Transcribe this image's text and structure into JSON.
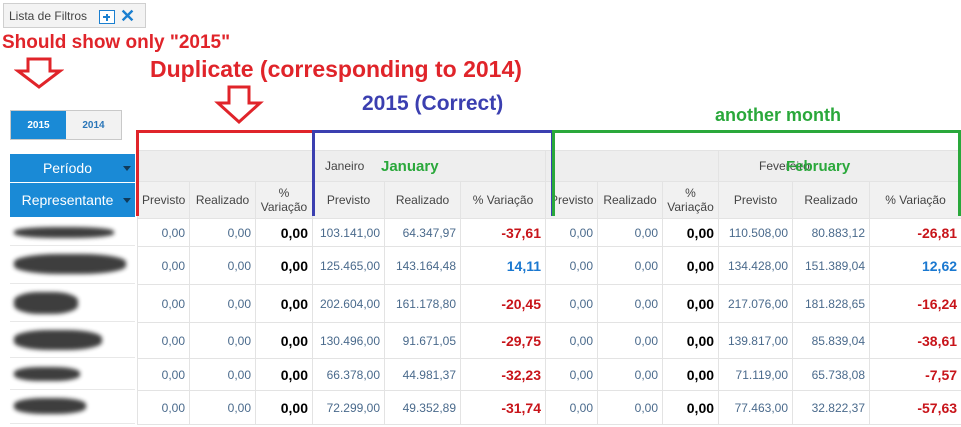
{
  "filter_tab": {
    "label": "Lista de Filtros"
  },
  "annotations": {
    "show_only": "Should show only \"2015\"",
    "duplicate": "Duplicate (corresponding to 2014)",
    "correct": "2015 (Correct)",
    "another_month": "another month",
    "january": "January",
    "february": "February"
  },
  "years": [
    "2015",
    "2014"
  ],
  "fields": {
    "periodo": "Período",
    "representante": "Representante"
  },
  "months": [
    "Janeiro",
    "Fevereiro"
  ],
  "columns": {
    "previsto": "Previsto",
    "realizado": "Realizado",
    "variacao": "% Variação",
    "variacao_short": "%",
    "variacao_word": "Variação"
  },
  "colors": {
    "accent": "#1a8ad6",
    "negative": "#c8141a",
    "positive": "#1a78d0",
    "anno_red": "#e0242a",
    "anno_blue": "#3b3fb0",
    "anno_green": "#2aa83b"
  },
  "rows": [
    {
      "dup": [
        "0,00",
        "0,00",
        "0,00"
      ],
      "jan": [
        "103.141,00",
        "64.347,97",
        "-37,61"
      ],
      "feb_dup": [
        "0,00",
        "0,00",
        "0,00"
      ],
      "feb": [
        "110.508,00",
        "80.883,12",
        "-26,81"
      ]
    },
    {
      "dup": [
        "0,00",
        "0,00",
        "0,00"
      ],
      "jan": [
        "125.465,00",
        "143.164,48",
        "14,11"
      ],
      "feb_dup": [
        "0,00",
        "0,00",
        "0,00"
      ],
      "feb": [
        "134.428,00",
        "151.389,04",
        "12,62"
      ]
    },
    {
      "dup": [
        "0,00",
        "0,00",
        "0,00"
      ],
      "jan": [
        "202.604,00",
        "161.178,80",
        "-20,45"
      ],
      "feb_dup": [
        "0,00",
        "0,00",
        "0,00"
      ],
      "feb": [
        "217.076,00",
        "181.828,65",
        "-16,24"
      ]
    },
    {
      "dup": [
        "0,00",
        "0,00",
        "0,00"
      ],
      "jan": [
        "130.496,00",
        "91.671,05",
        "-29,75"
      ],
      "feb_dup": [
        "0,00",
        "0,00",
        "0,00"
      ],
      "feb": [
        "139.817,00",
        "85.839,04",
        "-38,61"
      ]
    },
    {
      "dup": [
        "0,00",
        "0,00",
        "0,00"
      ],
      "jan": [
        "66.378,00",
        "44.981,37",
        "-32,23"
      ],
      "feb_dup": [
        "0,00",
        "0,00",
        "0,00"
      ],
      "feb": [
        "71.119,00",
        "65.738,08",
        "-7,57"
      ]
    },
    {
      "dup": [
        "0,00",
        "0,00",
        "0,00"
      ],
      "jan": [
        "72.299,00",
        "49.352,89",
        "-31,74"
      ],
      "feb_dup": [
        "0,00",
        "0,00",
        "0,00"
      ],
      "feb": [
        "77.463,00",
        "32.822,37",
        "-57,63"
      ]
    }
  ]
}
